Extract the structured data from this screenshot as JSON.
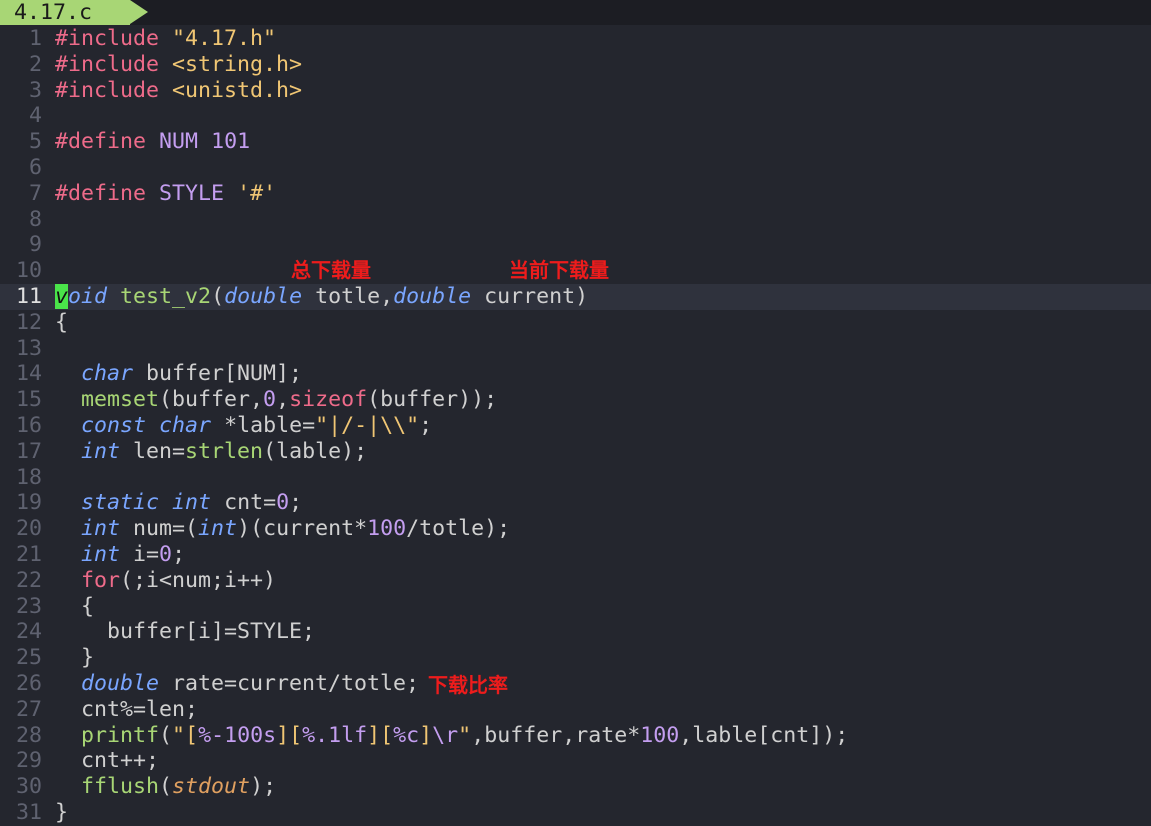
{
  "tab": {
    "label": "4.17.c"
  },
  "lines": [
    {
      "n": "1",
      "text": "#include \"4.17.h\""
    },
    {
      "n": "2",
      "text": "#include <string.h>"
    },
    {
      "n": "3",
      "text": "#include <unistd.h>"
    },
    {
      "n": "4",
      "text": ""
    },
    {
      "n": "5",
      "text": "#define NUM 101"
    },
    {
      "n": "6",
      "text": ""
    },
    {
      "n": "7",
      "text": "#define STYLE '#'"
    },
    {
      "n": "8",
      "text": ""
    },
    {
      "n": "9",
      "text": ""
    },
    {
      "n": "10",
      "text": ""
    },
    {
      "n": "11",
      "text": "void test_v2(double totle,double current)"
    },
    {
      "n": "12",
      "text": "{"
    },
    {
      "n": "13",
      "text": ""
    },
    {
      "n": "14",
      "text": "  char buffer[NUM];"
    },
    {
      "n": "15",
      "text": "  memset(buffer,0,sizeof(buffer));"
    },
    {
      "n": "16",
      "text": "  const char *lable=\"|/-|\\\\\";"
    },
    {
      "n": "17",
      "text": "  int len=strlen(lable);"
    },
    {
      "n": "18",
      "text": ""
    },
    {
      "n": "19",
      "text": "  static int cnt=0;"
    },
    {
      "n": "20",
      "text": "  int num=(int)(current*100/totle);"
    },
    {
      "n": "21",
      "text": "  int i=0;"
    },
    {
      "n": "22",
      "text": "  for(;i<num;i++)"
    },
    {
      "n": "23",
      "text": "  {"
    },
    {
      "n": "24",
      "text": "    buffer[i]=STYLE;"
    },
    {
      "n": "25",
      "text": "  }"
    },
    {
      "n": "26",
      "text": "  double rate=current/totle;"
    },
    {
      "n": "27",
      "text": "  cnt%=len;"
    },
    {
      "n": "28",
      "text": "  printf(\"[%-100s][%.1lf][%c]\\r\",buffer,rate*100,lable[cnt]);"
    },
    {
      "n": "29",
      "text": "  cnt++;"
    },
    {
      "n": "30",
      "text": "  fflush(stdout);"
    },
    {
      "n": "31",
      "text": "}"
    }
  ],
  "current_line": "11",
  "annotations": {
    "total": "总下载量",
    "current": "当前下载量",
    "rate": "下载比率"
  },
  "colors": {
    "background": "#24262e",
    "tab": "#a8d675",
    "cursor": "#4ae44a",
    "annotation": "#ee1c1c"
  }
}
